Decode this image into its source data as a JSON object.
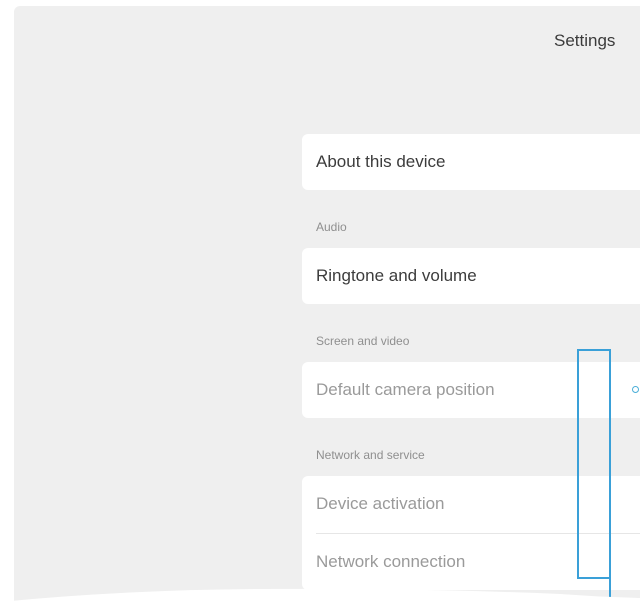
{
  "header": {
    "title": "Settings"
  },
  "items": {
    "about": "About this device",
    "ringtone": "Ringtone and volume",
    "camera": "Default camera position",
    "activation": "Device activation",
    "network": "Network connection"
  },
  "sections": {
    "audio": "Audio",
    "screen_video": "Screen and video",
    "network_service": "Network and service"
  },
  "colors": {
    "background": "#efefef",
    "accent": "#3aa0d8"
  }
}
